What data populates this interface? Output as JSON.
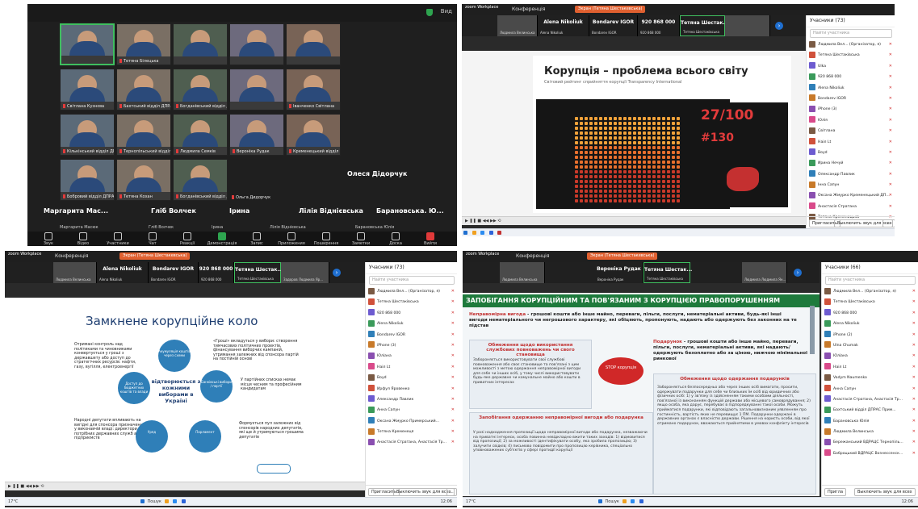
{
  "q1": {
    "view_label": "Вид",
    "tiles": [
      {
        "name": "",
        "active": true
      },
      {
        "name": "Тетяна Білецька",
        "active": false
      },
      {
        "name": "",
        "active": false
      },
      {
        "name": "",
        "active": false
      },
      {
        "name": "",
        "active": false
      },
      {
        "name": "Світлана Кузнєва",
        "active": false
      },
      {
        "name": "Бахтський відділ ДПРАС Західної",
        "active": false
      },
      {
        "name": "Богданівський відділ ДПРАС Тер...",
        "active": false
      },
      {
        "name": "",
        "active": false
      },
      {
        "name": "Іванченко Світлана",
        "active": false
      },
      {
        "name": "Кількінський відділ ДПРАС",
        "active": false
      },
      {
        "name": "Тернопільський відділ ДПРАС Ві...",
        "active": false
      },
      {
        "name": "Людмила Семків",
        "active": false
      },
      {
        "name": "Вероніка Рудак",
        "active": false
      },
      {
        "name": "Кременецький відділ ДПРАС",
        "active": false
      },
      {
        "name": "Бобровий відділ ДПРАС 1 ДРАТ1 (відпр...",
        "active": false
      },
      {
        "name": "Тетяна Кохан",
        "active": false
      },
      {
        "name": "Богданівський відділ ДПРАС ТЕР...",
        "active": false
      },
      {
        "name": "Ольга Дидорчук",
        "active": false
      }
    ],
    "big_names": [
      "Олеся Дідорчук",
      "Маргарита Мас...",
      "Гліб Волчек",
      "Ірина",
      "Лілія Віднієвська",
      "Барановська. Ю..."
    ],
    "sub_names": [
      "Маргарита Масюк",
      "Гліб Волчек",
      "Ірина",
      "Лілія Віднієвська",
      "Барановська Юлія"
    ],
    "toolbar": [
      "Звук",
      "Відео",
      "Участники",
      "Чат",
      "Реакції",
      "Демонстрація",
      "Запис",
      "Приложения",
      "Поширення",
      "Заметки",
      "Доска сообщений",
      "Вийти"
    ]
  },
  "zoom": {
    "logo": "zoom Workplace",
    "conf_label": "Конференція",
    "pill_label": "Экран (Тетяна Шестакевська)"
  },
  "q2": {
    "strip": [
      "Людмила Вел...",
      "Alena Nikoliuk",
      "Bondarev IGOR",
      "920 868 000",
      "Тетяна Шестак...",
      ""
    ],
    "strip_sub": [
      "Людмила Велинська",
      "Alena Nikoliuk",
      "Bondarev IGOR",
      "920 868 000",
      "Тетяна Шестаківська",
      ""
    ],
    "slide_title": "Корупція – проблема всього світу",
    "slide_subtitle": "Світовий рейтинг сприйняття корупції Transparency International",
    "score": "27/100",
    "rank": "#130",
    "participants_header": "Учасники (73)",
    "search": "Найти участника",
    "participants": [
      "Людмила Вел... (Організатор, я)",
      "Тетяна Шестаківська",
      "Ulka",
      "920 868 000",
      "Alena Nikoliuk",
      "Bondarev IGOR",
      "iPhone (3)",
      "Юлія",
      "Світлана",
      "Наіл Lt",
      "Boyd",
      "Ирина Нечуй",
      "Олександр Павлик",
      "Інна Сапун",
      "Оксана Жмурко Кременецький ДП...",
      "Анастасія Стратана",
      "Тетяна Кременицька"
    ],
    "foot": [
      "Пригласить",
      "Выключить звук для всех",
      "..."
    ]
  },
  "q3": {
    "strip": [
      "Alena Nikoliuk",
      "Bondarev IGOR",
      "920 868 000",
      "Тетяна Шестак...",
      ""
    ],
    "strip_sub": [
      "Людмила Велинська",
      "Alena Nikoliuk",
      "Bondarev IGOR",
      "920 868 000",
      "Тетяна Шестаківська",
      "Задоров Людмила Яр..."
    ],
    "slide_title": "Замкнене корупційне коло",
    "center_text": "відтворюється з кожними виборами в Україні",
    "left1": "Отримані контроль над політиками та чиновниками конвертується у гроші з державшету або доступ до стратегічних ресурсів: нафти, газу, вугілля, електроенергії",
    "left2": "Народні депутати впливають на вигідні для спонсора призначення у виконавчій владі: директори потрібних державних служб або підприємств",
    "right1": "«Гроші» вкладуться у вибори: створення тимчасових політичних проектів, фінансування виборчих кампаній, утримання залежних від спонсора партій на постійній основі",
    "right2": "У партійних списках немає місця чесним та професійним кандидатам",
    "right3": "Формується пул залежних від спонсорів народних депутатів, які ще й утримуються грошима депутатів",
    "circles": [
      "Акумуляція коштів через схеми",
      "Банківські вибори / партії",
      "Доступ до бюджетних коштів та влади",
      "Уряд",
      "Парламент"
    ],
    "participants_header": "Учасники (73)",
    "search": "Найти участника",
    "participants": [
      "Людмила Вел... (Організатор, я)",
      "Тетяна Шестаківська",
      "920 868 000",
      "Alena Nikoliuk",
      "Bondarev IGOR",
      "iPhone (3)",
      "Юліана",
      "Наіл Lt",
      "Boyd",
      "Ирфул Яровенко",
      "Александр Павлик",
      "Анна Сапун",
      "Оксана Жмурко Примерський...",
      "Тетяна Кременеця",
      "Анастасія Стратана, Анастасія Тр..."
    ],
    "foot": [
      "Пригласить",
      "Выключить звук для всех",
      "..."
    ]
  },
  "q4": {
    "strip": [
      "Вероніка Рудак",
      "Тетяна Шестак...",
      ""
    ],
    "strip_sub": [
      "Людмила Велинська",
      "Вероніка Рудак",
      "Тетяна Шестаківська",
      "Людмила Людмила Ян..."
    ],
    "banner": "ЗАПОБІГАННЯ КОРУПЦІЙНИМ ТА ПОВ'ЯЗАНИМ З КОРУПЦІЄЮ ПРАВОПОРУШЕННЯМ",
    "def1_term": "Неправомірна вигода",
    "def1_text": " - грошові кошти або інше майно, переваги, пільги, послуги, нематеріальні активи, будь-які інші вигоди нематеріального чи негрошового характеру, які обіцяють, пропонують, надають або одержують без законних на те підстав",
    "def2_term": "Подарунок",
    "def2_text": " - грошові кошти або інше майно, переваги, пільги, послуги, нематеріальні активи, які надають/одержують безоплатно або за ціною, нижчою мінімальної ринкової",
    "box1_title": "Обмеження щодо використання службових повноважень чи свого становища",
    "box1_text": "Забороняється використовувати свої службові повноваження або своє становище та пов'язані з цим можливості з метою одержання неправомірної вигоди для себе чи інших осіб, у тому числі використовувати будь-яке державне чи комунальне майно або кошти в приватних інтересах",
    "stop_label": "STOP корупція",
    "box2_title": "Запобігання одержанню неправомірної вигоди або подарунка",
    "box2_text": "У разі надходження пропозиції щодо неправомірної вигоди або подарунка, незважаючи на приватні інтереси, особа повинна невідкладно вжити таких заходів: 1) відмовитися від пропозиції; 2) за можливості ідентифікувати особу, яка зробила пропозицію; 3) залучити свідків; 4) письмово повідомити про пропозицію керівника, спеціально уповноважених суб'єктів у сфері протидії корупції",
    "box3_title": "Обмеження щодо одержання подарунків",
    "box3_text": "Забороняється безпосередньо або через інших осіб вимагати, просити, одержувати подарунки для себе чи близьких їм осіб від юридичних або фізичних осіб: 1) у зв'язку із здійсненням такими особами діяльності, пов'язаної із виконанням функцій держави або місцевого самоврядування; 2) якщо особа, яка дарує, перебуває в підпорядкуванні такої особи. Можуть прийматися подарунки, які відповідають загальновизнаним уявленням про гостинність, вартість яких не перевищує 1 ПМ. Подарунки одержані в державних органах є власністю держави. Рішення на користь особи, від якої отримано подарунок, вважаються прийнятими в умовах конфлікту інтересів",
    "participants_header": "Учасники (66)",
    "search": "Найти участника",
    "participants": [
      "Людмила Вел... (Організатор, я)",
      "Тетяна Шестаківська",
      "920 868 000",
      "Alena Nikoliuk",
      "iPhone (2)",
      "Ulna Chumak",
      "Юліана",
      "Наіл Lt",
      "Vadym Naumenko",
      "Анна Сапун",
      "Анастасія Стратана, Анастасія Тр...",
      "Бахтський відділ ДПРАС Прим...",
      "Барановська Юлія",
      "Людмила Велинська",
      "Бережанський ВДРАЦС Тернопіль...",
      "Боброцький ВДРАЦС Вознессенск..."
    ],
    "foot": [
      "Пригла",
      "Выключить звук для всех"
    ]
  },
  "taskbar": {
    "weather": "17°C",
    "search": "Пошук",
    "time": "12:06"
  },
  "colors": {
    "zoom_dark": "#1f1f1f",
    "active_green": "#3fbf5f",
    "zoom_blue": "#1f6fd0",
    "alert_red": "#d03030",
    "banner_green": "#1e7a3c"
  }
}
